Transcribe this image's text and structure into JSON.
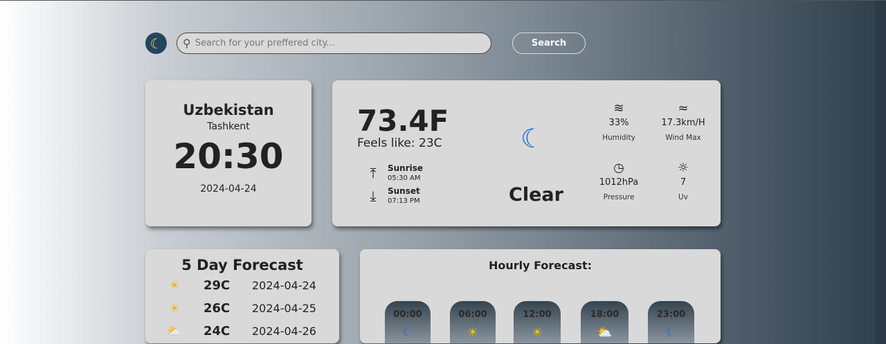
{
  "search": {
    "placeholder": "Search for your preffered city...",
    "button": "Search"
  },
  "location": {
    "country": "Uzbekistan",
    "city": "Tashkent",
    "time": "20:30",
    "date": "2024-04-24"
  },
  "current": {
    "temperature": "73.4F",
    "feels_like": "Feels like: 23C",
    "condition": "Clear",
    "icon": "moon-icon",
    "sunrise": {
      "label": "Sunrise",
      "time": "05:30 AM"
    },
    "sunset": {
      "label": "Sunset",
      "time": "07:13 PM"
    },
    "stats": [
      {
        "value": "33%",
        "label": "Humidity",
        "icon": "humidity-icon"
      },
      {
        "value": "17.3km/H",
        "label": "Wind Max",
        "icon": "wind-icon"
      },
      {
        "value": "1012hPa",
        "label": "Pressure",
        "icon": "pressure-icon"
      },
      {
        "value": "7",
        "label": "Uv",
        "icon": "uv-icon"
      }
    ]
  },
  "forecast": {
    "title": "5 Day Forecast",
    "days": [
      {
        "temp": "29C",
        "date": "2024-04-24",
        "icon": "sun-icon"
      },
      {
        "temp": "26C",
        "date": "2024-04-25",
        "icon": "sun-icon"
      },
      {
        "temp": "24C",
        "date": "2024-04-26",
        "icon": "partly-cloudy-icon"
      }
    ]
  },
  "hourly": {
    "title": "Hourly Forecast:",
    "hours": [
      {
        "time": "00:00",
        "icon": "moon-icon"
      },
      {
        "time": "06:00",
        "icon": "sun-icon"
      },
      {
        "time": "12:00",
        "icon": "sun-icon"
      },
      {
        "time": "18:00",
        "icon": "partly-cloudy-icon"
      },
      {
        "time": "23:00",
        "icon": "moon-icon"
      }
    ]
  }
}
